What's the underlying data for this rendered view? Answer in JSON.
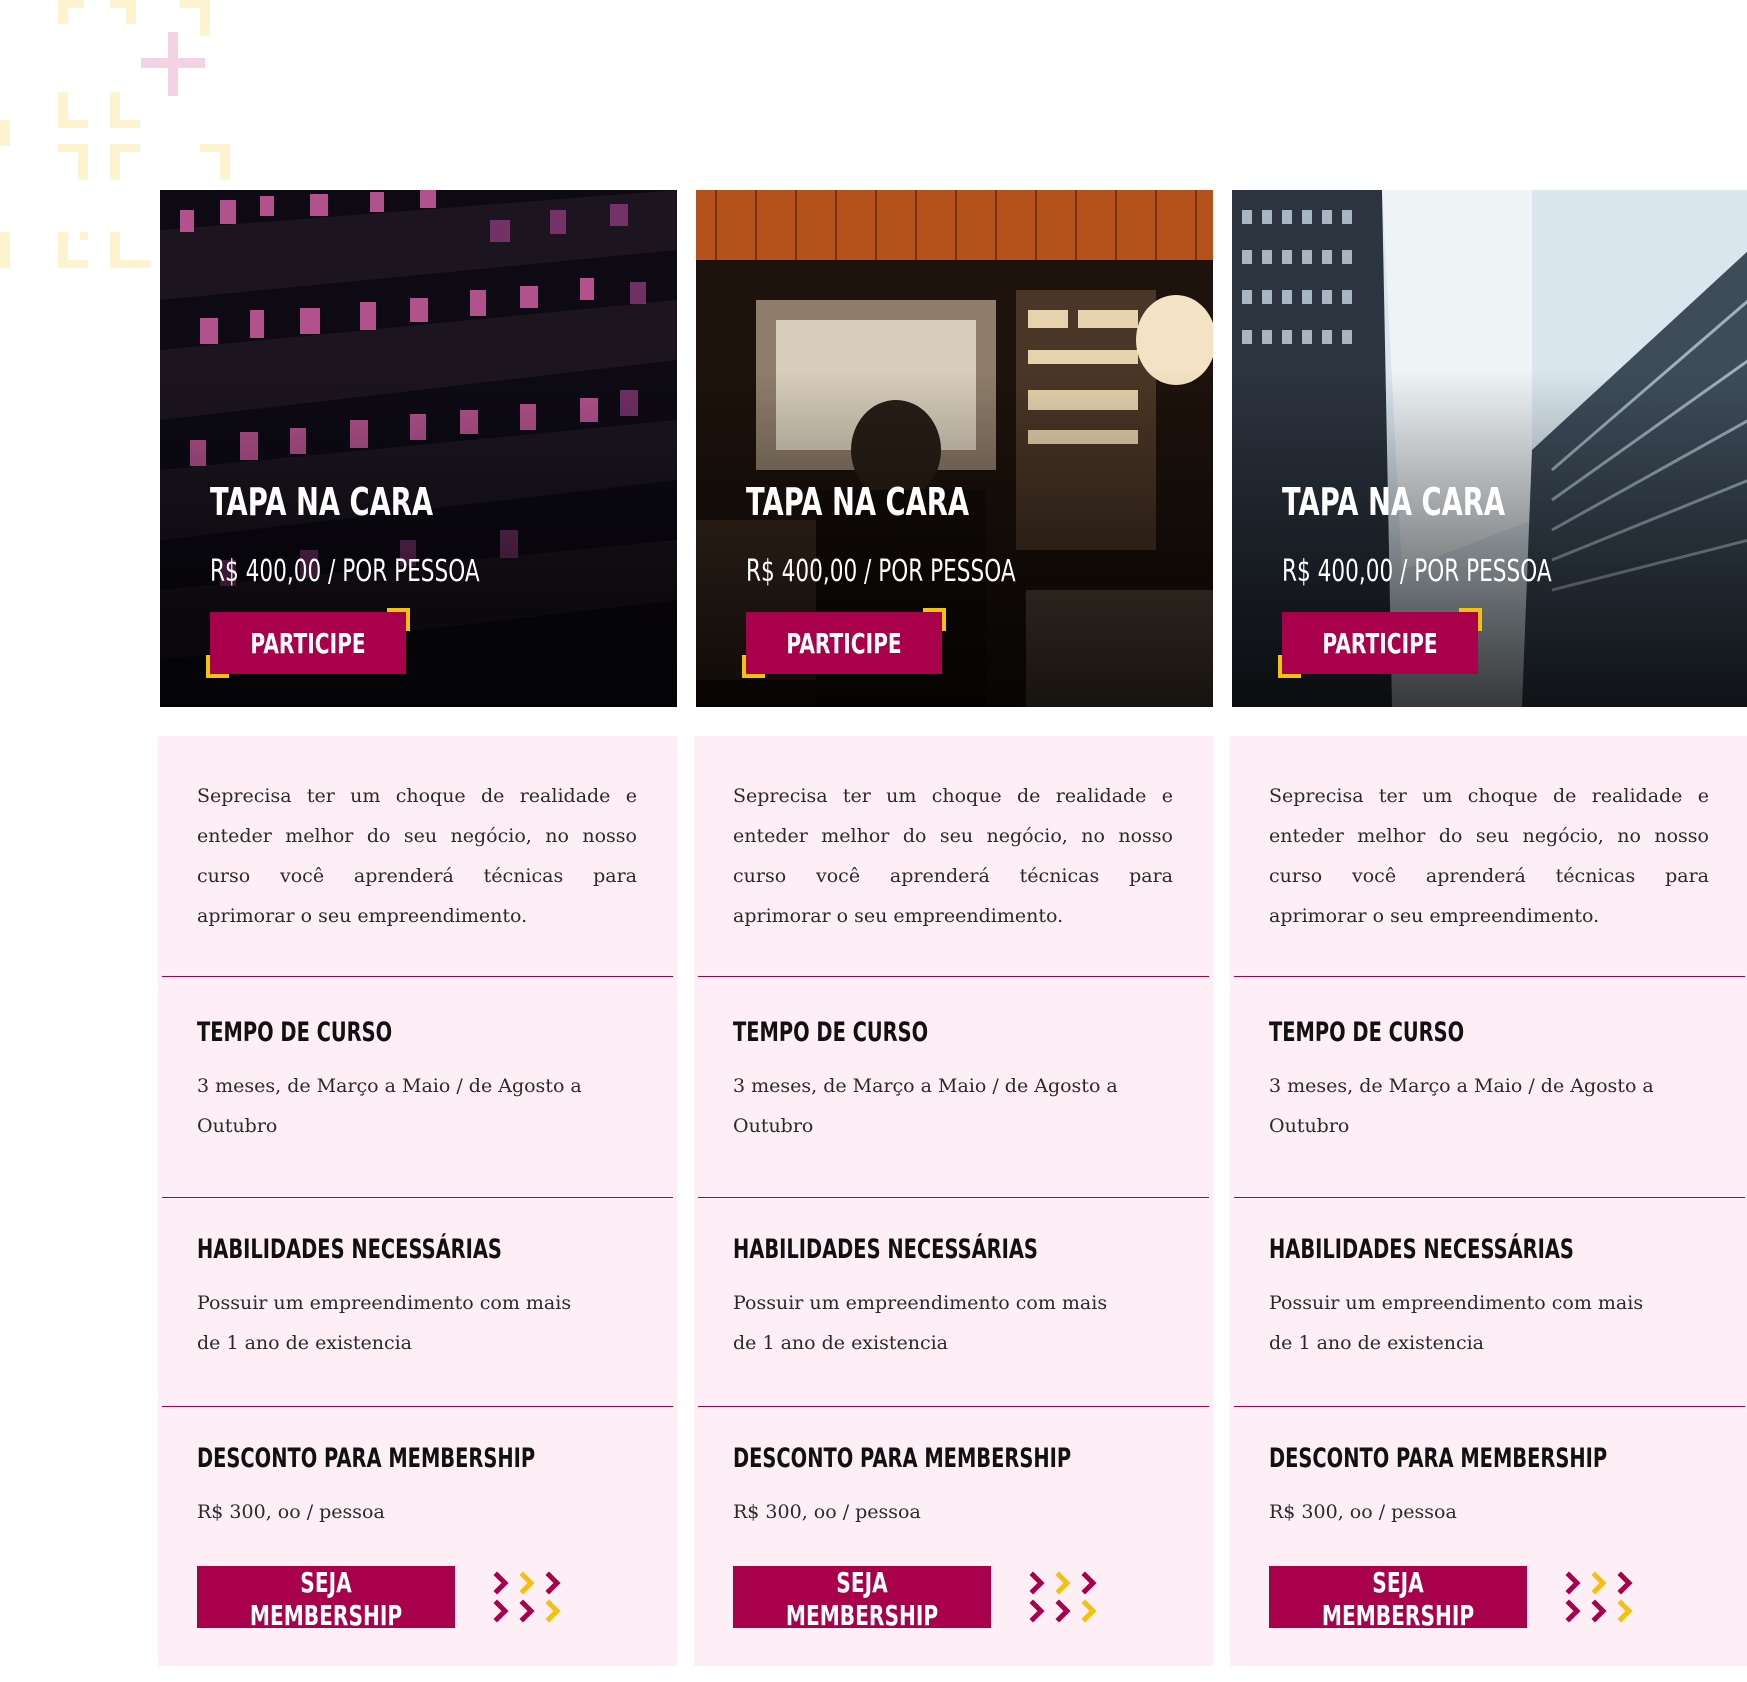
{
  "colors": {
    "accent": "#a8004a",
    "highlight": "#f2c20c",
    "card_bg": "#fdeff5"
  },
  "cards": [
    {
      "image": "night office building with pink-lit windows",
      "title": "TAPA NA CARA",
      "price": "R$ 400,00 / POR PESSOA",
      "cta": "PARTICIPE",
      "description": "Seprecisa ter um choque de realidade e enteder melhor do seu negócio, no nosso curso você aprenderá técnicas para aprimorar o seu empreendimento.",
      "sections": [
        {
          "title": "TEMPO DE CURSO",
          "text": "3 meses, de Março a Maio / de Agosto a Outubro"
        },
        {
          "title": "HABILIDADES NECESSÁRIAS",
          "text": "Possuir um empreendimento com mais de 1 ano de existencia"
        },
        {
          "title": "DESCONTO PARA MEMBERSHIP",
          "text": "R$ 300, oo / pessoa"
        }
      ],
      "member_button": "SEJA MEMBERSHIP"
    },
    {
      "image": "recording studio with person at mixing console",
      "title": "TAPA NA CARA",
      "price": "R$ 400,00 / POR PESSOA",
      "cta": "PARTICIPE",
      "description": "Seprecisa ter um choque de realidade e enteder melhor do seu negócio, no nosso curso você aprenderá técnicas para aprimorar o seu empreendimento.",
      "sections": [
        {
          "title": "TEMPO DE CURSO",
          "text": "3 meses, de Março a Maio / de Agosto a Outubro"
        },
        {
          "title": "HABILIDADES NECESSÁRIAS",
          "text": "Possuir um empreendimento com mais de 1 ano de existencia"
        },
        {
          "title": "DESCONTO PARA MEMBERSHIP",
          "text": "R$ 300, oo / pessoa"
        }
      ],
      "member_button": "SEJA MEMBERSHIP"
    },
    {
      "image": "skyscrapers viewed from below",
      "title": "TAPA NA CARA",
      "price": "R$ 400,00 / POR PESSOA",
      "cta": "PARTICIPE",
      "description": "Seprecisa ter um choque de realidade e enteder melhor do seu negócio, no nosso curso você aprenderá técnicas para aprimorar o seu empreendimento.",
      "sections": [
        {
          "title": "TEMPO DE CURSO",
          "text": "3 meses, de Março a Maio / de Agosto a Outubro"
        },
        {
          "title": "HABILIDADES NECESSÁRIAS",
          "text": "Possuir um empreendimento com mais de 1 ano de existencia"
        },
        {
          "title": "DESCONTO PARA MEMBERSHIP",
          "text": "R$ 300, oo / pessoa"
        }
      ],
      "member_button": "SEJA MEMBERSHIP"
    }
  ]
}
